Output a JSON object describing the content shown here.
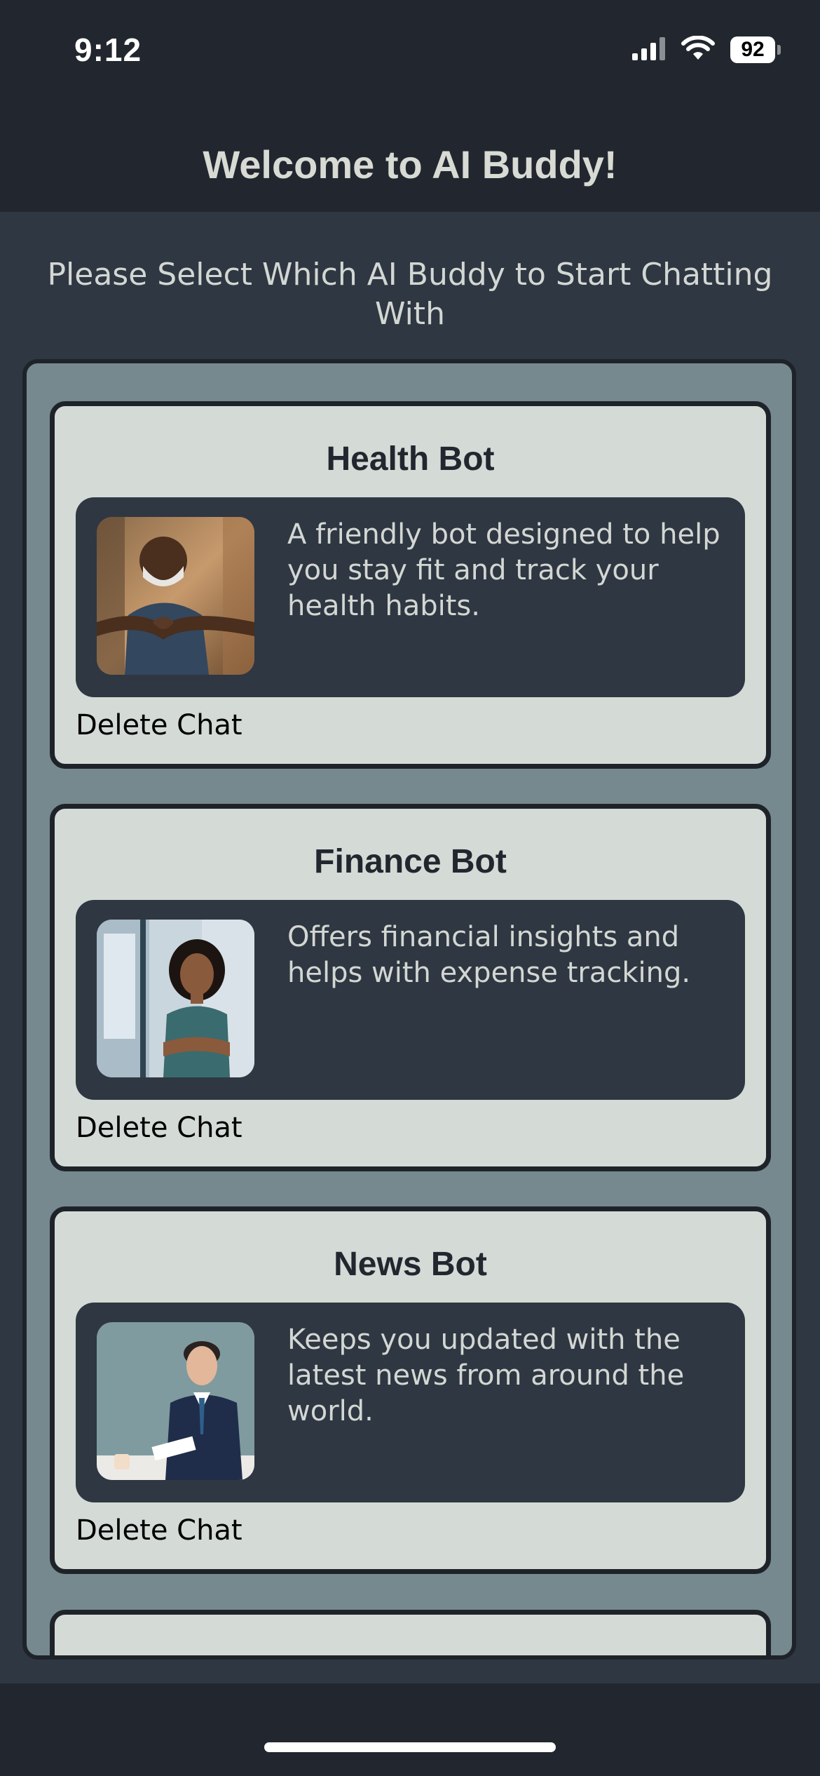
{
  "status_bar": {
    "time": "9:12",
    "battery": "92",
    "icons": [
      "signal-icon",
      "wifi-icon",
      "battery-icon"
    ]
  },
  "header": {
    "title": "Welcome to AI Buddy!"
  },
  "main": {
    "subtitle": "Please Select Which AI Buddy to Start Chatting With",
    "bots": [
      {
        "name": "Health Bot",
        "description": "A friendly bot designed to help you stay fit and track your health habits.",
        "delete_label": "Delete Chat",
        "avatar": "health-bot-avatar"
      },
      {
        "name": "Finance Bot",
        "description": "Offers financial insights and helps with expense tracking.",
        "delete_label": "Delete Chat",
        "avatar": "finance-bot-avatar"
      },
      {
        "name": "News Bot",
        "description": "Keeps you updated with the latest news from around the world.",
        "delete_label": "Delete Chat",
        "avatar": "news-bot-avatar"
      }
    ]
  },
  "colors": {
    "background_dark": "#22272f",
    "main_background": "#2f3742",
    "panel_background": "#76898e",
    "card_background": "#d4dad5",
    "text_light": "#d3d7d3",
    "text_dark": "#22272f"
  }
}
